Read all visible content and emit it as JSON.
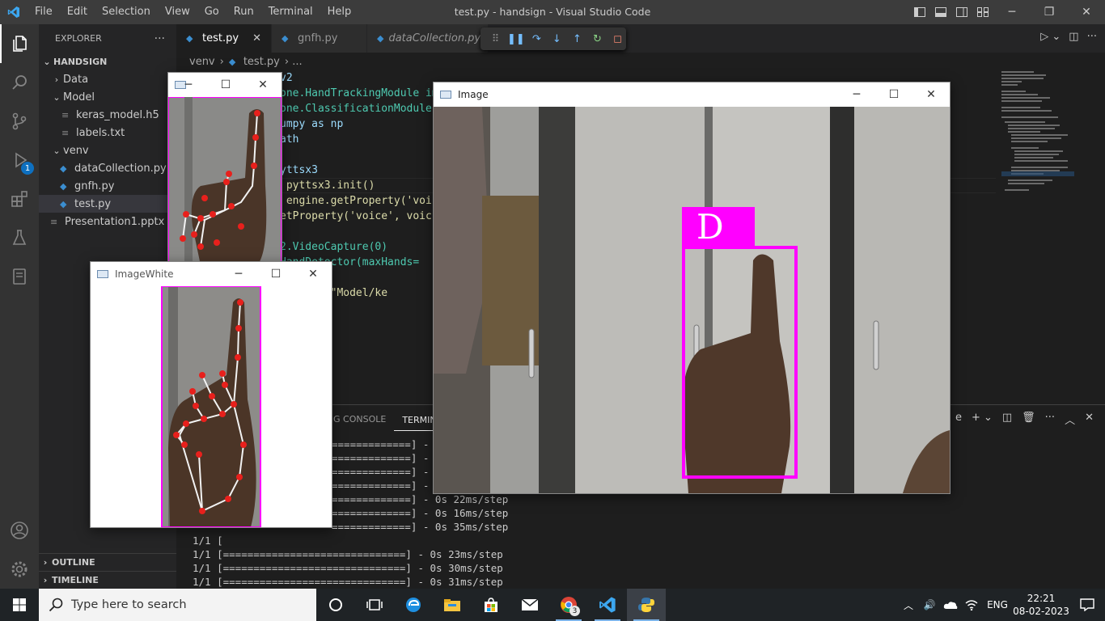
{
  "titlebar": {
    "menu": [
      "File",
      "Edit",
      "Selection",
      "View",
      "Go",
      "Run",
      "Terminal",
      "Help"
    ],
    "window_title": "test.py - handsign - Visual Studio Code"
  },
  "activity": {
    "debug_badge": "1"
  },
  "explorer": {
    "header": "EXPLORER",
    "more": "···",
    "root": "HANDSIGN",
    "items": [
      {
        "label": "Data",
        "kind": "folder",
        "depth": 1,
        "open": false
      },
      {
        "label": "Model",
        "kind": "folder",
        "depth": 1,
        "open": true
      },
      {
        "label": "keras_model.h5",
        "kind": "file",
        "depth": 2
      },
      {
        "label": "labels.txt",
        "kind": "file",
        "depth": 2
      },
      {
        "label": "venv",
        "kind": "folder",
        "depth": 1,
        "open": true
      },
      {
        "label": "dataCollection.py",
        "kind": "py",
        "depth": 2
      },
      {
        "label": "gnfh.py",
        "kind": "py",
        "depth": 2
      },
      {
        "label": "test.py",
        "kind": "py",
        "depth": 2,
        "selected": true
      },
      {
        "label": "Presentation1.pptx",
        "kind": "file",
        "depth": 1
      }
    ],
    "outline": "OUTLINE",
    "timeline": "TIMELINE"
  },
  "tabs": [
    {
      "label": "test.py",
      "active": true,
      "close": "✕"
    },
    {
      "label": "gnfh.py",
      "active": false
    },
    {
      "label": "dataCollection.py",
      "active": false
    }
  ],
  "breadcrumb": {
    "folder": "venv",
    "sep": "›",
    "file": "test.py",
    "tail": "›  ..."
  },
  "code": [
    "v2",
    "one.HandTrackingModule im",
    "one.ClassificationModule",
    "umpy as np",
    "ath",
    "",
    "yttsx3",
    " pyttsx3.init()",
    " engine.getProperty('voic",
    "etProperty('voice', voic",
    "",
    "2.VideoCapture(0)",
    "HandDetector(maxHands=",
    "",
    "ssifier(\"Model/ke"
  ],
  "panel": {
    "tabs": [
      "G CONSOLE",
      "TERMINA"
    ],
    "shell_tail": "e",
    "terminal_lines": [
      "=============] - 0s 2",
      "=============] - 0s 2",
      "=============] - 0s 2",
      "=============] - 0s 2",
      "=============] - 0s 22ms/step",
      "=============] - 0s 16ms/step",
      "=============] - 0s 35ms/step",
      "1/1 [",
      "1/1 [==============================] - 0s 23ms/step",
      "1/1 [==============================] - 0s 30ms/step",
      "1/1 [==============================] - 0s 31ms/step"
    ]
  },
  "windows": {
    "image": {
      "title": "Image",
      "prediction": "D"
    },
    "image_white": {
      "title": "ImageWhite"
    }
  },
  "taskbar": {
    "search_placeholder": "Type here to search",
    "lang": "ENG",
    "time": "22:21",
    "date": "08-02-2023",
    "chrome_badge": "3"
  },
  "colors": {
    "accent": "#ff00ff",
    "vscode_blue": "#3ca7f0",
    "landmark": "#e8201c"
  }
}
